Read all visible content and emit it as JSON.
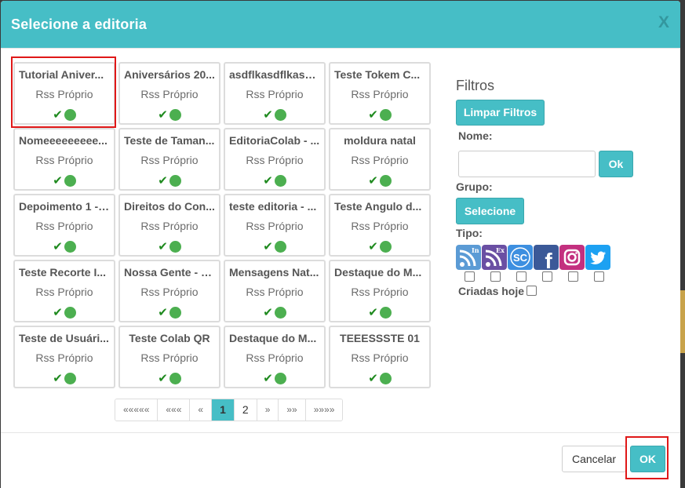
{
  "modal": {
    "title": "Selecione a editoria",
    "close_label": "X"
  },
  "cards": [
    {
      "title": "Tutorial Aniver...",
      "subtitle": "Rss Próprio"
    },
    {
      "title": "Aniversários 20...",
      "subtitle": "Rss Próprio"
    },
    {
      "title": "asdflkasdflkasd...",
      "subtitle": "Rss Próprio"
    },
    {
      "title": "Teste Tokem C...",
      "subtitle": "Rss Próprio"
    },
    {
      "title": "Nomeeeeeeeee...",
      "subtitle": "Rss Próprio"
    },
    {
      "title": "Teste de Taman...",
      "subtitle": "Rss Próprio"
    },
    {
      "title": "EditoriaColab - ...",
      "subtitle": "Rss Próprio"
    },
    {
      "title": "moldura natal",
      "subtitle": "Rss Próprio"
    },
    {
      "title": "Depoimento 1 - ...",
      "subtitle": "Rss Próprio"
    },
    {
      "title": "Direitos do Con...",
      "subtitle": "Rss Próprio"
    },
    {
      "title": "teste editoria - ...",
      "subtitle": "Rss Próprio"
    },
    {
      "title": "Teste Angulo d...",
      "subtitle": "Rss Próprio"
    },
    {
      "title": "Teste Recorte I...",
      "subtitle": "Rss Próprio"
    },
    {
      "title": "Nossa Gente - F...",
      "subtitle": "Rss Próprio"
    },
    {
      "title": "Mensagens Nat...",
      "subtitle": "Rss Próprio"
    },
    {
      "title": "Destaque do M...",
      "subtitle": "Rss Próprio"
    },
    {
      "title": "Teste de Usuári...",
      "subtitle": "Rss Próprio"
    },
    {
      "title": "Teste Colab QR",
      "subtitle": "Rss Próprio"
    },
    {
      "title": "Destaque do M...",
      "subtitle": "Rss Próprio"
    },
    {
      "title": "TEEESSSTE 01",
      "subtitle": "Rss Próprio"
    }
  ],
  "pagination": {
    "first": "«««««",
    "prev_many": "«««",
    "prev": "«",
    "pages": [
      "1",
      "2"
    ],
    "current": "1",
    "next": "»",
    "next_many": "»»",
    "last": "»»»»"
  },
  "filters": {
    "title": "Filtros",
    "clear_button": "Limpar Filtros",
    "name_label": "Nome:",
    "name_value": "",
    "name_ok": "Ok",
    "group_label": "Grupo:",
    "group_button": "Selecione",
    "type_label": "Tipo:",
    "types": [
      {
        "icon": "rss-in-icon",
        "badge": "In",
        "color": "#5b9bd5"
      },
      {
        "icon": "rss-ex-icon",
        "badge": "Ex",
        "color": "#6a4fa3"
      },
      {
        "icon": "soundcloud-sc-icon",
        "badge": "SC",
        "color": "#3d8fe0"
      },
      {
        "icon": "facebook-icon",
        "badge": "f",
        "color": "#3b5998"
      },
      {
        "icon": "instagram-icon",
        "badge": "",
        "color": "#c3307f"
      },
      {
        "icon": "twitter-icon",
        "badge": "",
        "color": "#1da1f2"
      }
    ],
    "created_today_label": "Criadas hoje"
  },
  "footer": {
    "cancel": "Cancelar",
    "ok": "OK"
  }
}
